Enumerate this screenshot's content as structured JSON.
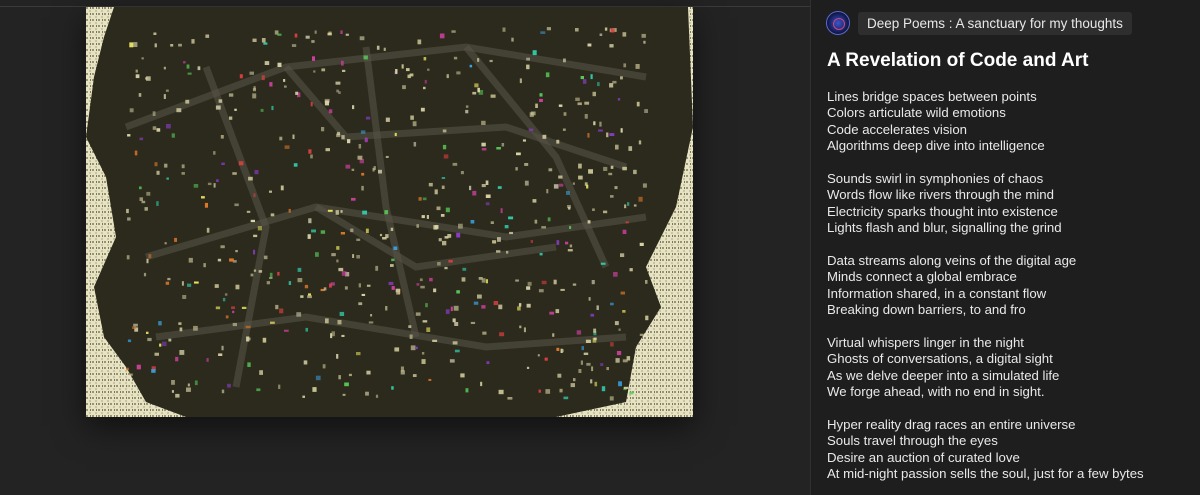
{
  "blog": {
    "avatar_icon": "blog-avatar-icon",
    "name": "Deep Poems : A sanctuary for my thoughts"
  },
  "post": {
    "title": "A Revelation of Code and Art",
    "stanzas": [
      [
        "Lines bridge spaces between points",
        "Colors articulate wild emotions",
        "Code accelerates vision",
        "Algorithms deep dive into intelligence"
      ],
      [
        "Sounds swirl in symphonies of chaos",
        "Words flow like rivers through the mind",
        "Electricity sparks thought into existence",
        "Lights flash and blur, signalling the grind"
      ],
      [
        "Data streams along veins of the digital age",
        "Minds connect a global embrace",
        "Information shared, in a constant flow",
        "Breaking down barriers, to and fro"
      ],
      [
        "Virtual whispers linger in the night",
        "Ghosts of conversations, a digital sight",
        "As we delve deeper into a simulated life",
        "We forge ahead, with no end in sight."
      ],
      [
        "Hyper reality drag races an entire universe",
        "Souls travel through the eyes",
        "Desire an auction of curated love",
        "At mid-night passion sells the soul, just for a few bytes"
      ]
    ]
  },
  "colors": {
    "page_bg": "#232323",
    "panel_bg": "#1e1e1e",
    "artwork_dark": "#2b2a1c",
    "artwork_light": "#e6e2c4",
    "title_text": "#ffffff",
    "body_text": "#e9e9e9"
  }
}
